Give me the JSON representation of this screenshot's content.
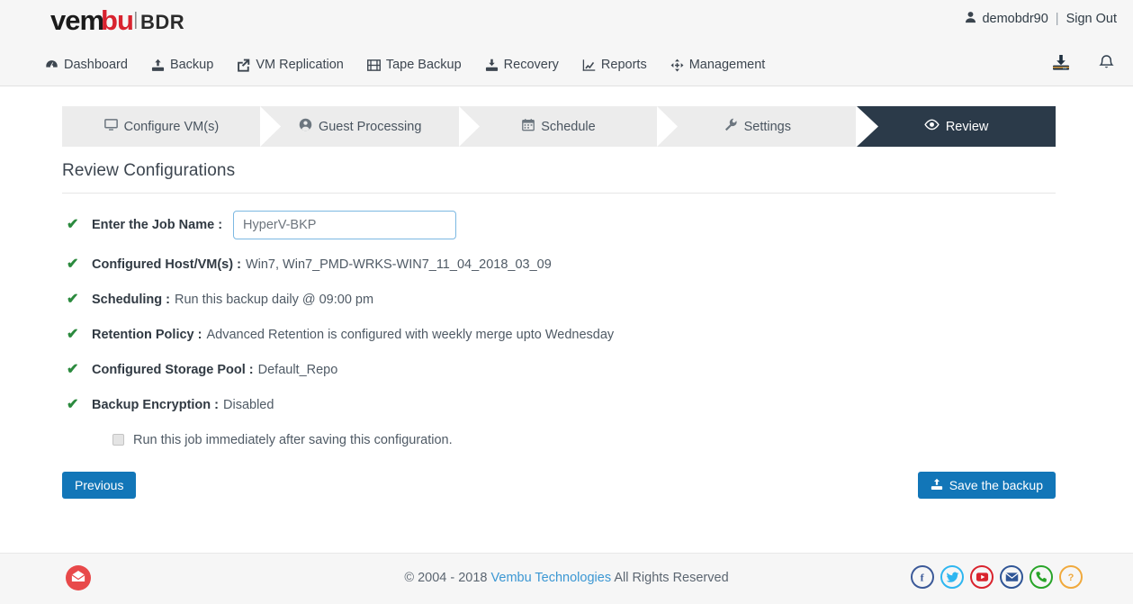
{
  "brand": {
    "name": "vembu",
    "product": "BDR",
    "accent_red": "#d8232f",
    "accent_dark": "#1b1b1b"
  },
  "account": {
    "user_icon": "user-icon",
    "username": "demobdr90",
    "separator": "|",
    "sign_out": "Sign Out"
  },
  "nav": {
    "items": [
      {
        "label": "Dashboard",
        "icon": "dashboard-icon"
      },
      {
        "label": "Backup",
        "icon": "upload-icon"
      },
      {
        "label": "VM Replication",
        "icon": "share-square-icon"
      },
      {
        "label": "Tape Backup",
        "icon": "film-icon"
      },
      {
        "label": "Recovery",
        "icon": "download-icon"
      },
      {
        "label": "Reports",
        "icon": "chart-line-icon"
      },
      {
        "label": "Management",
        "icon": "arrows-move-icon"
      }
    ],
    "tools": [
      {
        "icon": "download-tray-icon",
        "name": "downloads"
      },
      {
        "icon": "bell-icon",
        "name": "notifications"
      }
    ]
  },
  "wizard": {
    "steps": [
      {
        "label": "Configure VM(s)",
        "icon": "desktop-icon",
        "active": false
      },
      {
        "label": "Guest Processing",
        "icon": "user-circle-icon",
        "active": false
      },
      {
        "label": "Schedule",
        "icon": "calendar-icon",
        "active": false
      },
      {
        "label": "Settings",
        "icon": "wrench-icon",
        "active": false
      },
      {
        "label": "Review",
        "icon": "eye-icon",
        "active": true
      }
    ],
    "active_color": "#2b3a49",
    "inactive_color": "#ececec"
  },
  "review": {
    "title": "Review Configurations",
    "job_name": {
      "label": "Enter the Job Name :",
      "value": "HyperV-BKP",
      "placeholder": "HyperV-BKP"
    },
    "rows": [
      {
        "key": "Configured Host/VM(s) :",
        "value": "Win7, Win7_PMD-WRKS-WIN7_11_04_2018_03_09"
      },
      {
        "key": "Scheduling :",
        "value": "Run this backup daily @ 09:00 pm"
      },
      {
        "key": "Retention Policy :",
        "value": "Advanced Retention is configured with weekly merge upto Wednesday"
      },
      {
        "key": "Configured Storage Pool :",
        "value": "Default_Repo"
      },
      {
        "key": "Backup Encryption :",
        "value": "Disabled"
      }
    ],
    "run_now": {
      "label": "Run this job immediately after saving this configuration.",
      "checked": false
    },
    "check_mark": "✔"
  },
  "buttons": {
    "previous": "Previous",
    "save": "Save the backup",
    "save_icon": "upload-icon",
    "primary_color": "#1276b8"
  },
  "footer": {
    "copyright_prefix": "© 2004 - 2018",
    "company_link": "Vembu Technologies",
    "copyright_suffix": "All Rights Reserved",
    "feedback_icon": "envelope-open-icon",
    "socials": [
      {
        "name": "facebook-icon",
        "glyph": "f",
        "color": "#3b5998"
      },
      {
        "name": "twitter-icon",
        "glyph": "t",
        "color": "#2eb6f0"
      },
      {
        "name": "youtube-icon",
        "glyph": "yt",
        "color": "#d9232d"
      },
      {
        "name": "email-icon",
        "glyph": "e",
        "color": "#2f5596"
      },
      {
        "name": "phone-icon",
        "glyph": "p",
        "color": "#28a428"
      },
      {
        "name": "help-icon",
        "glyph": "?",
        "color": "#f5a game"
      }
    ]
  }
}
